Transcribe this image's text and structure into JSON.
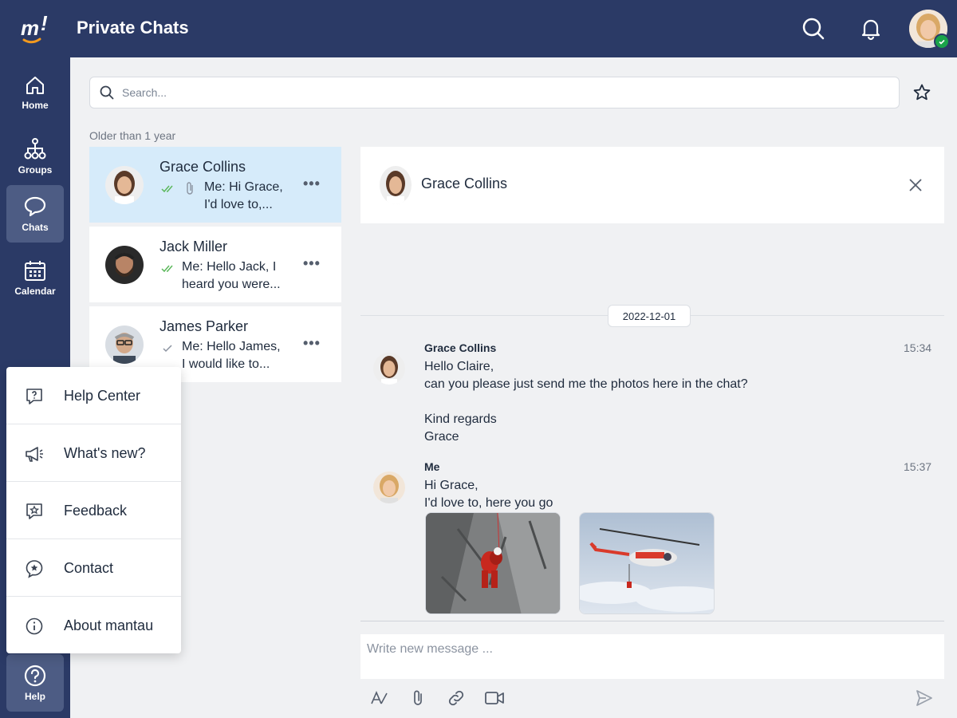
{
  "header": {
    "title": "Private Chats"
  },
  "nav": {
    "items": [
      {
        "label": "Home",
        "icon": "home-icon"
      },
      {
        "label": "Groups",
        "icon": "groups-icon"
      },
      {
        "label": "Chats",
        "icon": "chat-bubble-icon",
        "active": true
      },
      {
        "label": "Calendar",
        "icon": "calendar-icon"
      }
    ],
    "help": {
      "label": "Help",
      "icon": "help-icon"
    }
  },
  "search": {
    "placeholder": "Search..."
  },
  "chat_list": {
    "section": "Older than 1 year",
    "items": [
      {
        "name": "Grace Collins",
        "preview_line1": "Me: Hi Grace,",
        "preview_line2": "I'd love to,...",
        "status": "read",
        "has_attachment": true,
        "selected": true
      },
      {
        "name": "Jack Miller",
        "preview_line1": "Me: Hello Jack, I",
        "preview_line2": "heard you were...",
        "status": "read"
      },
      {
        "name": "James Parker",
        "preview_line1": "Me: Hello James,",
        "preview_line2": "I would like to...",
        "status": "sent"
      }
    ]
  },
  "conversation": {
    "title": "Grace Collins",
    "date": "2022-12-01",
    "messages": [
      {
        "sender": "Grace Collins",
        "time": "15:34",
        "lines": [
          "Hello Claire,",
          "can you please just send me the photos here in the chat?",
          "",
          "Kind regards",
          "Grace"
        ]
      },
      {
        "sender": "Me",
        "time": "15:37",
        "lines": [
          "Hi Grace,",
          "I'd love to, here you go"
        ]
      }
    ],
    "compose_placeholder": "Write new message ..."
  },
  "help_menu": {
    "items": [
      {
        "label": "Help Center",
        "icon": "help-center-icon"
      },
      {
        "label": "What's new?",
        "icon": "megaphone-icon"
      },
      {
        "label": "Feedback",
        "icon": "feedback-icon"
      },
      {
        "label": "Contact",
        "icon": "contact-icon"
      },
      {
        "label": "About mantau",
        "icon": "info-icon"
      }
    ]
  },
  "colors": {
    "primary": "#2b3a66",
    "selected_chat": "#d6ebfa",
    "online": "#1aa34a",
    "check": "#5cb85c"
  }
}
